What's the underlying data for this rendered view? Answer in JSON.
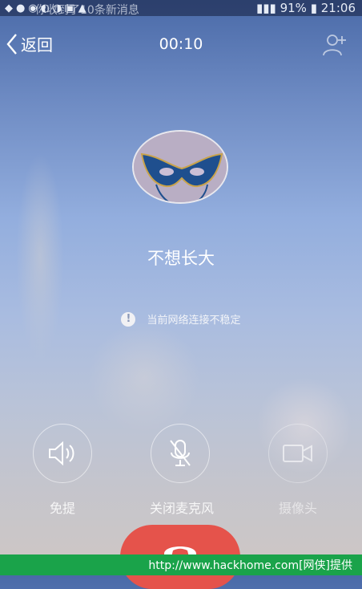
{
  "status_bar": {
    "notice": "你收到了10条新消息",
    "battery": "91%",
    "time": "21:06"
  },
  "topbar": {
    "back_label": "返回",
    "timer": "00:10",
    "add_contact_icon": "add-user-icon"
  },
  "contact": {
    "name": "不想长大",
    "avatar_icon": "mask-icon"
  },
  "warning": {
    "icon": "exclamation-icon",
    "text": "当前网络连接不稳定"
  },
  "controls": [
    {
      "label": "免提",
      "icon": "speaker-icon",
      "enabled": true
    },
    {
      "label": "关闭麦克风",
      "icon": "mic-off-icon",
      "enabled": true
    },
    {
      "label": "摄像头",
      "icon": "camera-icon",
      "enabled": false
    }
  ],
  "hangup": {
    "icon": "phone-hangup-icon",
    "color": "#e5534b"
  },
  "footer": {
    "text": "http://www.hackhome.com[网侠]提供"
  },
  "colors": {
    "accent_red": "#e5534b",
    "footer_green": "#1aa34a"
  }
}
